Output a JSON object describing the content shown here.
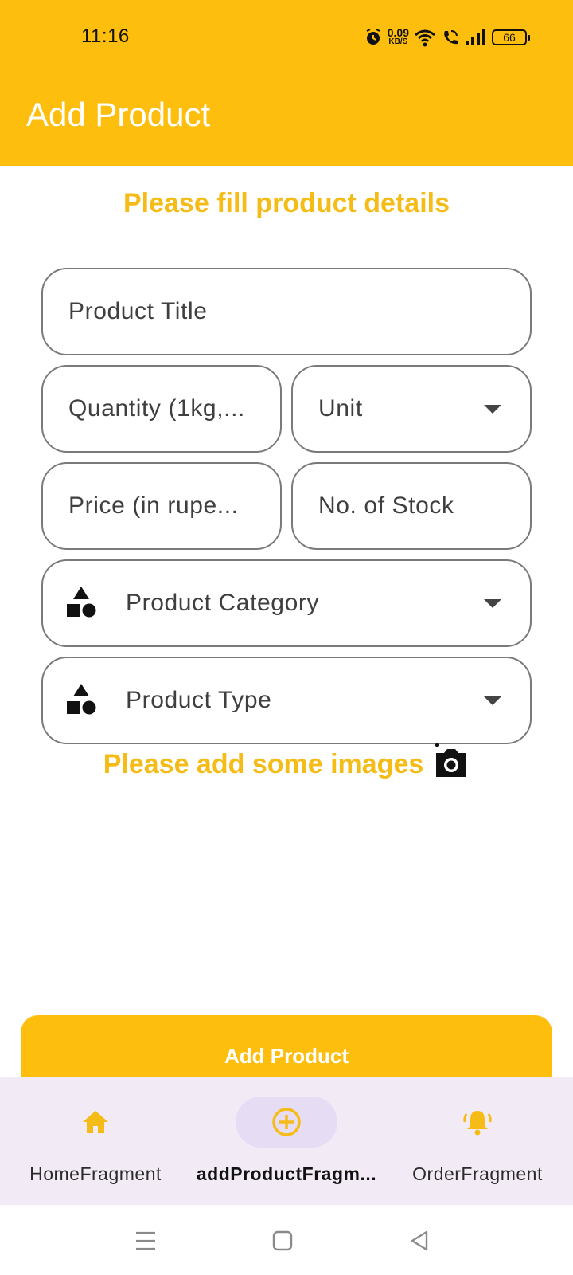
{
  "status_bar": {
    "time": "11:16",
    "net_speed_value": "0.09",
    "net_speed_unit": "KB/S",
    "battery": "66",
    "icons": [
      "alarm-icon",
      "wifi-icon",
      "wifi-call-icon",
      "signal-icon",
      "battery-icon"
    ]
  },
  "app_bar": {
    "title": "Add Product"
  },
  "form": {
    "heading": "Please fill product details",
    "product_title_placeholder": "Product Title",
    "quantity_placeholder": "Quantity (1kg,...",
    "unit_placeholder": "Unit",
    "price_placeholder": "Price (in rupe...",
    "stock_placeholder": "No. of Stock",
    "category_placeholder": "Product Category",
    "type_placeholder": "Product Type",
    "images_prompt": "Please add some images",
    "submit_label": "Add Product"
  },
  "bottom_nav": {
    "items": [
      {
        "label": "HomeFragment",
        "icon": "home-icon",
        "active": false
      },
      {
        "label": "addProductFragm...",
        "icon": "add-circle-icon",
        "active": true
      },
      {
        "label": "OrderFragment",
        "icon": "notification-bell-icon",
        "active": false
      }
    ]
  },
  "system_nav": {
    "icons": [
      "menu-icon",
      "home-square-icon",
      "back-triangle-icon"
    ]
  },
  "colors": {
    "accent": "#FDBE0E",
    "accent_text": "#F5BC17",
    "nav_bg": "#F2EBF5",
    "nav_active": "#E6DDF5"
  }
}
